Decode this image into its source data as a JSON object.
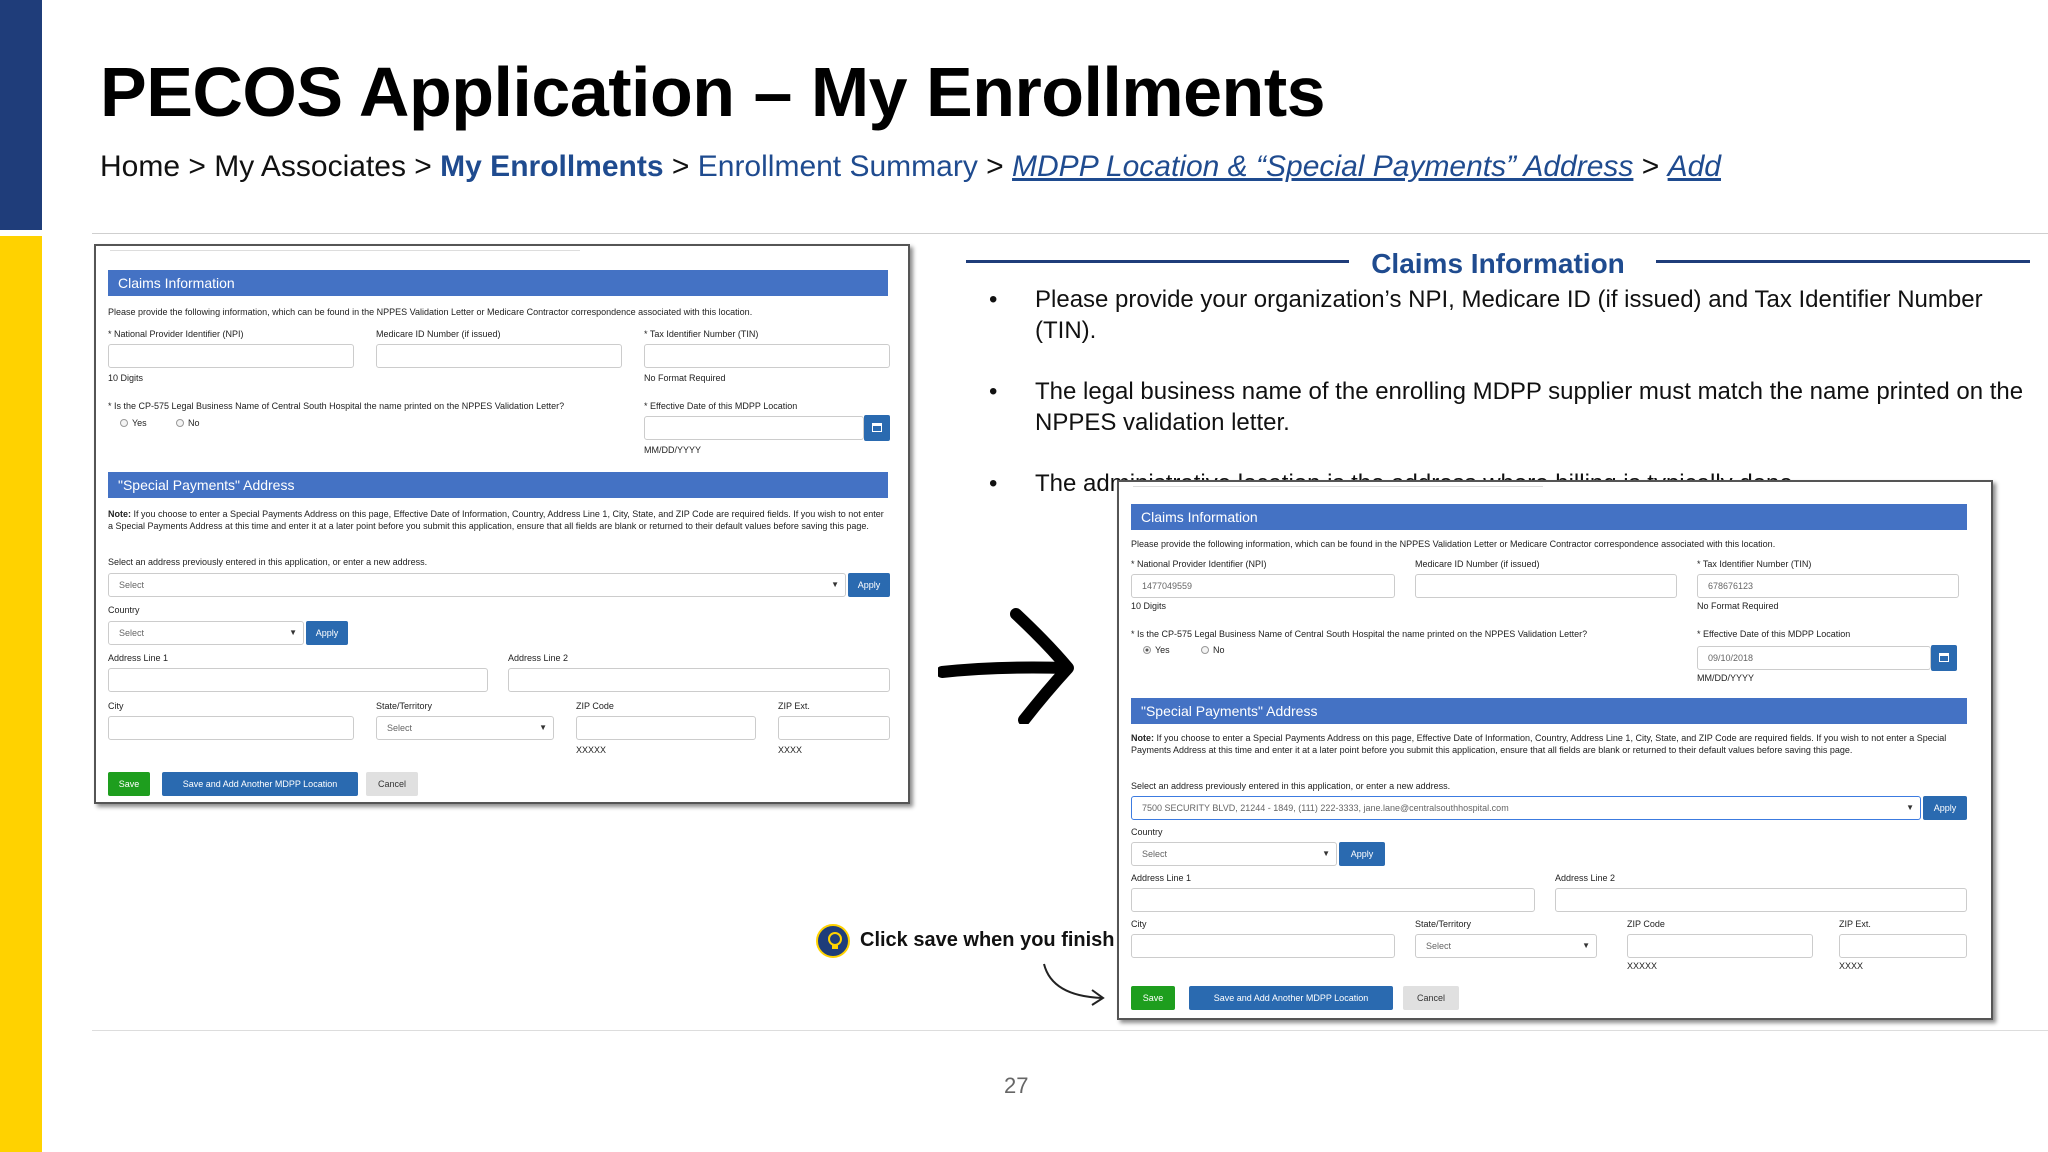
{
  "slide": {
    "title": "PECOS Application – My Enrollments",
    "page_number": "27",
    "breadcrumb": {
      "home": "Home",
      "sep": " > ",
      "associates": "My Associates",
      "enrollments": "My Enrollments",
      "summary": "Enrollment Summary",
      "mdpp": "MDPP Location & “Special Payments” Address",
      "add": "Add"
    }
  },
  "info": {
    "heading": "Claims Information",
    "bullets": [
      "Please provide your organization’s NPI, Medicare ID (if issued) and Tax Identifier Number (TIN).",
      "The legal business name of the enrolling MDPP supplier must match the name printed on the NPPES validation letter.",
      "The administrative location is the address where billing is typically done."
    ]
  },
  "callout": {
    "text": "Click save when you finish"
  },
  "form": {
    "claims_header": "Claims Information",
    "claims_desc": "Please provide the following information, which can be found in the NPPES Validation Letter or Medicare Contractor correspondence associated with this location.",
    "npi_label": "* National Provider Identifier (NPI)",
    "medicare_label": "Medicare ID Number (if issued)",
    "tin_label": "* Tax Identifier Number (TIN)",
    "npi_hint": "10 Digits",
    "tin_hint": "No Format Required",
    "legal_name_question": "* Is the CP-575 Legal Business Name of Central South Hospital the name printed on the NPPES Validation Letter?",
    "yes": "Yes",
    "no": "No",
    "effective_date_label": "* Effective Date of this MDPP Location",
    "date_hint": "MM/DD/YYYY",
    "special_header": "\"Special Payments\" Address",
    "note_label": "Note:",
    "note_text": " If you choose to enter a Special Payments Address on this page, Effective Date of Information, Country, Address Line 1, City, State, and ZIP Code are required fields. If you wish to not enter a Special Payments Address at this time and enter it at a later point before you submit this application, ensure that all fields are blank or returned to their default values before saving this page.",
    "select_address_label": "Select an address previously entered in this application, or enter a new address.",
    "select_placeholder": "Select",
    "apply": "Apply",
    "country_label": "Country",
    "address1_label": "Address Line 1",
    "address2_label": "Address Line 2",
    "city_label": "City",
    "state_label": "State/Territory",
    "zip_label": "ZIP Code",
    "zipext_label": "ZIP Ext.",
    "zip_hint": "XXXXX",
    "zipext_hint": "XXXX",
    "save": "Save",
    "save_add_another": "Save and Add Another MDPP Location",
    "cancel": "Cancel"
  },
  "filled_values": {
    "npi": "1477049559",
    "tin": "678676123",
    "effective_date": "09/10/2018",
    "selected_address": "7500 SECURITY BLVD, 21244 - 1849, (111) 222-3333, jane.lane@centralsouthhospital.com",
    "legal_name_answer": "Yes"
  },
  "colors": {
    "navy": "#1f3d7a",
    "yellow": "#ffd200",
    "link_blue": "#1f4b8f",
    "panel_blue": "#4472c4",
    "button_blue": "#2a6ab0",
    "save_green": "#1e9e1e"
  }
}
